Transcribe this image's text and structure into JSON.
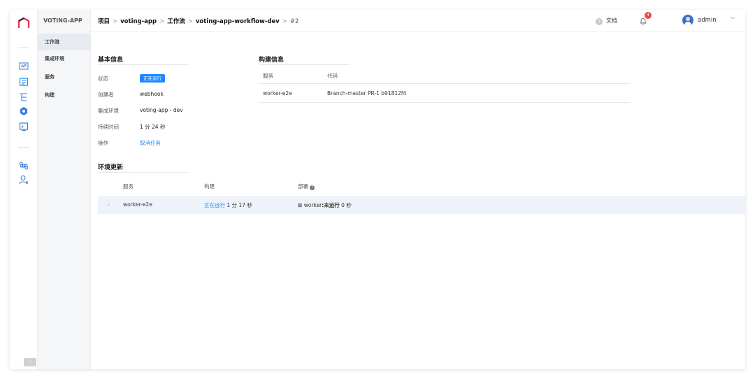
{
  "app": {
    "name": "VOTING-APP"
  },
  "subnav": {
    "items": [
      {
        "label": "工作流",
        "active": true
      },
      {
        "label": "集成环境",
        "active": false
      },
      {
        "label": "服务",
        "active": false
      },
      {
        "label": "构建",
        "active": false
      }
    ]
  },
  "breadcrumb": {
    "project_label": "项目",
    "project": "voting-app",
    "workflow_label": "工作流",
    "workflow": "voting-app-workflow-dev",
    "run": "#2",
    "separator": ">"
  },
  "header": {
    "docs_label": "文档",
    "notification_count": "4",
    "username": "admin"
  },
  "basic_info": {
    "title": "基本信息",
    "status_label": "状态",
    "status_value": "正在运行",
    "creator_label": "创建者",
    "creator_value": "webhook",
    "env_label": "集成环境",
    "env_value": "voting-app - dev",
    "duration_label": "持续时间",
    "duration_value": "1 分 24 秒",
    "action_label": "操作",
    "action_value": "取消任务"
  },
  "build_info": {
    "title": "构建信息",
    "col_service": "服务",
    "col_code": "代码",
    "rows": [
      {
        "service": "worker-e2e",
        "code": "Branch-master PR-1 b91812f4"
      }
    ]
  },
  "env_update": {
    "title": "环境更新",
    "col_service": "服务",
    "col_build": "构建",
    "col_deploy": "部署",
    "rows": [
      {
        "service": "worker-e2e",
        "build_status": "正在运行",
        "build_duration": "1 分 17 秒",
        "deploy_target": "worker",
        "deploy_status": ":未运行",
        "deploy_duration": "0 秒"
      }
    ]
  },
  "colors": {
    "accent": "#1b88ff",
    "badge": "#e54b4b"
  }
}
